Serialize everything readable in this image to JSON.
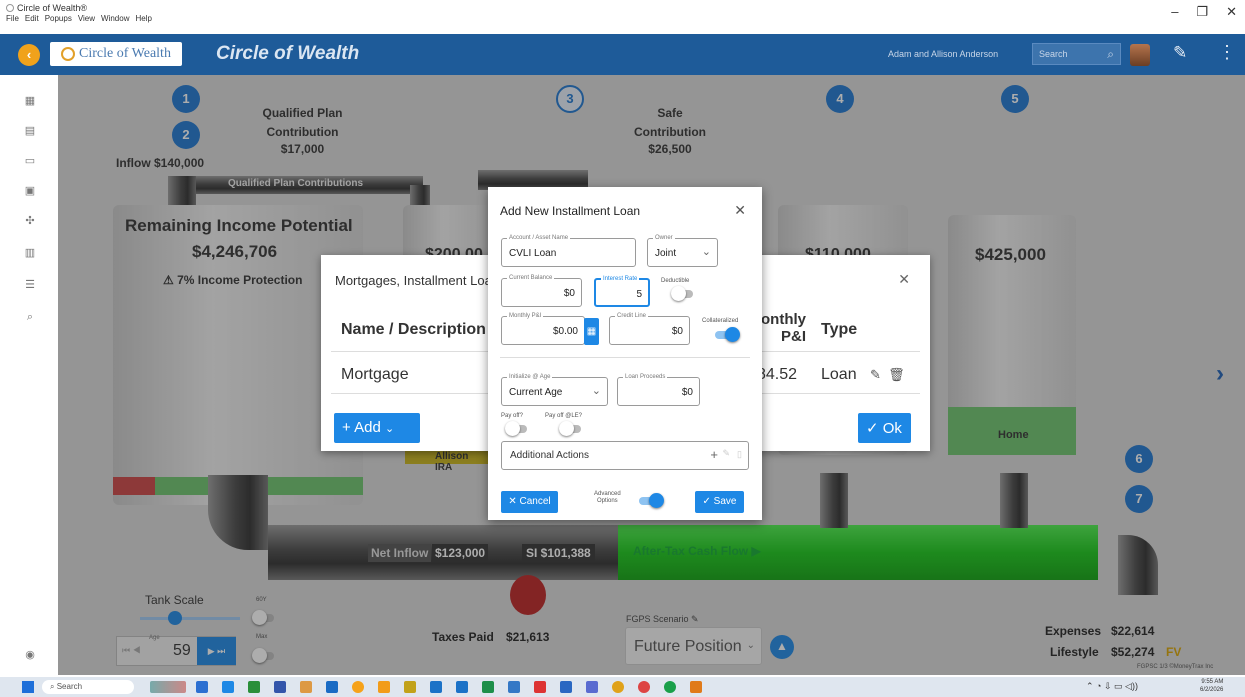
{
  "window": {
    "title": "Circle of Wealth®",
    "menu": [
      "File",
      "Edit",
      "Popups",
      "View",
      "Window",
      "Help"
    ],
    "controls": [
      "–",
      "❐",
      "✕"
    ]
  },
  "header": {
    "logo_text": "Circle of Wealth",
    "app_title": "Circle of Wealth",
    "user_name": "Adam and Allison Anderson",
    "search_placeholder": "Search"
  },
  "flow": {
    "steps": [
      "1",
      "2",
      "3",
      "4",
      "5",
      "6",
      "7"
    ],
    "qualified_plan": {
      "title": "Qualified Plan\nContribution",
      "amount": "$17,000"
    },
    "safe_contribution": {
      "title": "Safe\nContribution",
      "amount": "$26,500"
    },
    "inflow": "Inflow $140,000",
    "qualified_pipe_label": "Qualified Plan Contributions",
    "remaining_income_title": "Remaining Income Potential",
    "remaining_income_amount": "$4,246,706",
    "income_protection": "⚠ 7% Income Protection",
    "tank2_amount": "$200,00",
    "tank4_amount": "$110,000",
    "tank5_amount": "$425,000",
    "tank5_label": "Home",
    "allison_label": "Allison IRA",
    "net_inflow_label": "Net Inflow",
    "net_inflow_amount": "$123,000",
    "si_amount": "SI $101,388",
    "after_tax_label": "After-Tax Cash Flow ▶",
    "taxes_paid_label": "Taxes Paid",
    "taxes_paid_amount": "$21,613",
    "expenses_label": "Expenses",
    "expenses_amount": "$22,614",
    "lifestyle_label": "Lifestyle",
    "lifestyle_amount": "$52,274",
    "lifestyle_suffix": "FV",
    "footer_note": "FGPSC 1/3 ©MoneyTrax Inc"
  },
  "tank_scale": {
    "label": "Tank Scale",
    "toggle1_label": "60Y",
    "toggle2_label": "Max",
    "age_label": "Age",
    "age_value": "59"
  },
  "fgps": {
    "label": "FGPS Scenario",
    "value": "Future Position"
  },
  "bg_dialog": {
    "title": "Mortgages, Installment Loans",
    "col_name": "Name / Description",
    "col_pi": "onthly\nP&I",
    "col_type": "Type",
    "row_name": "Mortgage",
    "row_pi": "84.52",
    "row_type": "Loan",
    "add_label": "+ Add",
    "ok_label": "✓ Ok"
  },
  "modal": {
    "title": "Add New Installment Loan",
    "account_label": "Account / Asset Name",
    "account_value": "CVLI Loan",
    "owner_label": "Owner",
    "owner_value": "Joint",
    "balance_label": "Current Balance",
    "balance_value": "$0",
    "rate_label": "Interest Rate",
    "rate_value": "5",
    "deductible_label": "Deductible",
    "deductible_on": false,
    "monthly_label": "Monthly P&I",
    "monthly_value": "$0.00",
    "credit_label": "Credit Line",
    "credit_value": "$0",
    "collateralized_label": "Collateralized",
    "collateralized_on": true,
    "init_label": "Initialize @ Age",
    "init_value": "Current Age",
    "proceeds_label": "Loan Proceeds",
    "proceeds_value": "$0",
    "payoff_label": "Pay off?",
    "payoff_le_label": "Pay off @LE?",
    "additional_actions": "Additional Actions",
    "cancel_label": "✕ Cancel",
    "advanced_label": "Advanced\nOptions",
    "advanced_on": true,
    "save_label": "✓ Save"
  },
  "taskbar": {
    "search_placeholder": "Search",
    "time": "9:55 AM",
    "date": "6/2/2026"
  }
}
